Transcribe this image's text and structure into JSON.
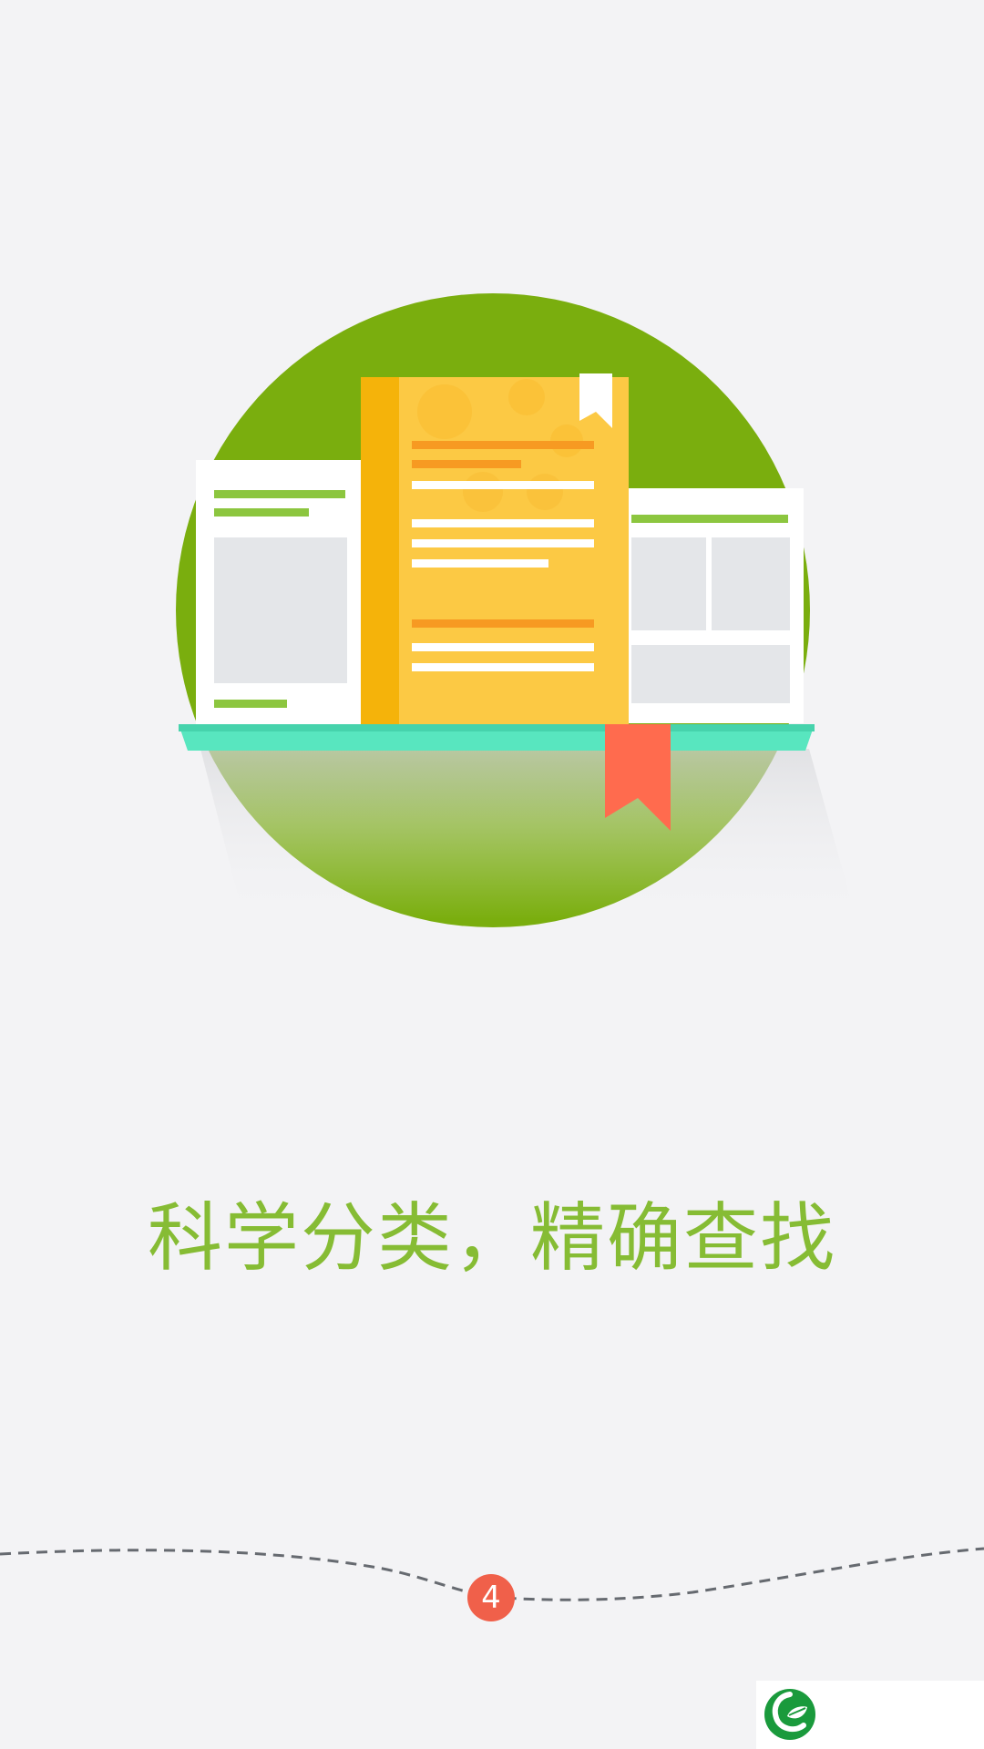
{
  "onboarding": {
    "headline": "科学分类，精确查找",
    "page_number": "4"
  },
  "icons": {
    "illustration": "bookshelf-illustration",
    "logo": "leaf-logo-icon"
  },
  "colors": {
    "background": "#f3f3f5",
    "accent_green": "#86bc34",
    "circle_green": "#7aae0e",
    "book_yellow": "#fcc944",
    "shelf_teal": "#58e6bf",
    "ribbon_red": "#ff6b4e",
    "badge_red": "#f0604a",
    "logo_green": "#1a9a3c"
  }
}
